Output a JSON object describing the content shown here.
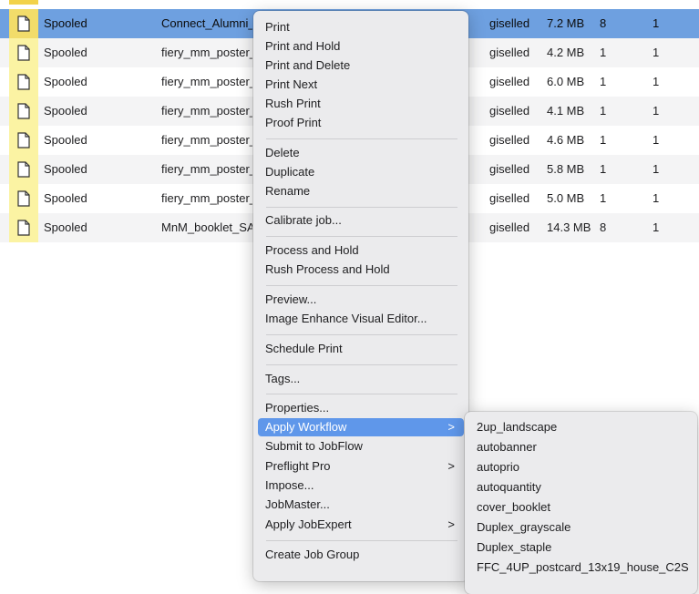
{
  "jobs": [
    {
      "status": "Spooled",
      "name": "Connect_Alumni_",
      "user": "giselled",
      "size": "7.2 MB",
      "pages": "8",
      "copies": "1",
      "icon": "document-icon"
    },
    {
      "status": "Spooled",
      "name": "fiery_mm_poster_",
      "user": "giselled",
      "size": "4.2 MB",
      "pages": "1",
      "copies": "1",
      "icon": "document-icon"
    },
    {
      "status": "Spooled",
      "name": "fiery_mm_poster_",
      "user": "giselled",
      "size": "6.0 MB",
      "pages": "1",
      "copies": "1",
      "icon": "document-icon"
    },
    {
      "status": "Spooled",
      "name": "fiery_mm_poster_",
      "user": "giselled",
      "size": "4.1 MB",
      "pages": "1",
      "copies": "1",
      "icon": "document-icon"
    },
    {
      "status": "Spooled",
      "name": "fiery_mm_poster_",
      "user": "giselled",
      "size": "4.6 MB",
      "pages": "1",
      "copies": "1",
      "icon": "document-icon"
    },
    {
      "status": "Spooled",
      "name": "fiery_mm_poster_",
      "user": "giselled",
      "size": "5.8 MB",
      "pages": "1",
      "copies": "1",
      "icon": "document-icon"
    },
    {
      "status": "Spooled",
      "name": "fiery_mm_poster_",
      "user": "giselled",
      "size": "5.0 MB",
      "pages": "1",
      "copies": "1",
      "icon": "document-icon"
    },
    {
      "status": "Spooled",
      "name": "MnM_booklet_SAI",
      "user": "giselled",
      "size": "14.3 MB",
      "pages": "8",
      "copies": "1",
      "icon": "document-icon"
    }
  ],
  "context_menu": {
    "items": [
      "Print",
      "Print and Hold",
      "Print and Delete",
      "Print Next",
      "Rush Print",
      "Proof Print",
      "Delete",
      "Duplicate",
      "Rename",
      "Calibrate job...",
      "Process and Hold",
      "Rush Process and Hold",
      "Preview...",
      "Image Enhance Visual Editor...",
      "Schedule Print",
      "Tags...",
      "Properties...",
      "Apply Workflow",
      "Submit to JobFlow",
      "Preflight Pro",
      "Impose...",
      "JobMaster...",
      "Apply JobExpert",
      "Create Job Group"
    ],
    "highlighted": "Apply Workflow",
    "submenu_chevron": ">"
  },
  "workflow_submenu": {
    "items": [
      "2up_landscape",
      "autobanner",
      "autoprio",
      "autoquantity",
      "cover_booklet",
      "Duplex_grayscale",
      "Duplex_staple",
      "FFC_4UP_postcard_13x19_house_C2S"
    ]
  },
  "colors": {
    "selection": "#6ea0e0",
    "menu_highlight": "#5f97ea",
    "icon_cell": "#fbf3a3",
    "menu_bg": "#ebebed"
  }
}
